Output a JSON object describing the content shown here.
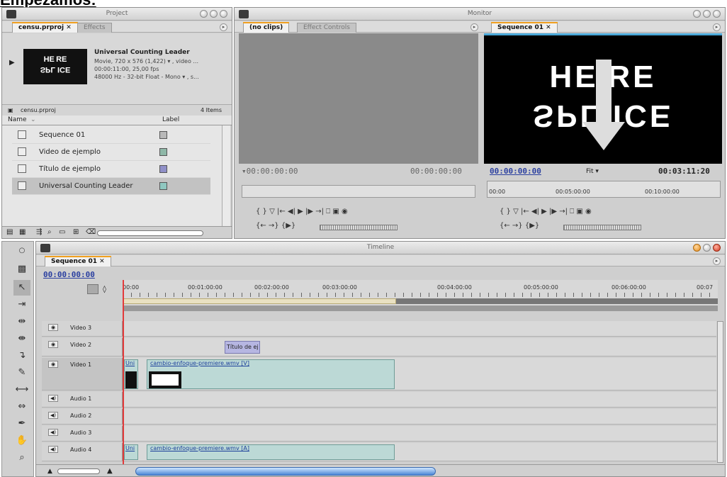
{
  "page_heading": "Empezamos:",
  "project": {
    "title": "Project",
    "tabs": [
      "censu.prproj",
      "Effects"
    ],
    "clip_name": "Universal Counting Leader",
    "clip_meta": [
      "Movie, 720 x 576 (1,422)  ▾ , video ...",
      "00:00:11:00, 25,00 fps",
      "48000 Hz - 32-bit Float - Mono  ▾ , s..."
    ],
    "thumb_top": "HE RE",
    "thumb_bottom": "SPL ICE",
    "bin_name": "censu.prproj",
    "item_count": "4 Items",
    "col_name": "Name",
    "col_label": "Label",
    "items": [
      {
        "name": "Sequence 01",
        "color": "#b8b8b8"
      },
      {
        "name": "Video de ejemplo",
        "color": "#8fb8a8"
      },
      {
        "name": "Título de ejemplo",
        "color": "#9090c8"
      },
      {
        "name": "Universal Counting Leader",
        "color": "#8fc7c0"
      }
    ]
  },
  "monitor": {
    "title": "Monitor",
    "source_tabs": [
      "(no clips)",
      "Effect Controls"
    ],
    "program_tab": "Sequence 01",
    "source_tc_left": "▾00:00:00:00",
    "source_tc_right": "00:00:00:00",
    "program_tc": "00:00:00:00",
    "fit": "Fit",
    "program_duration": "00:03:11:20",
    "preview_top": "HE RE",
    "preview_bottom": "SPL ICE",
    "ruler": [
      "00:00",
      "00:05:00:00",
      "00:10:00:00"
    ],
    "ctrl_row1": "{   }   ▽    |←  ◀|  ▶  |▶  →|    ⎕  ▣  ◉",
    "ctrl_row2": "{←  →}  {▶}",
    "prog_row1": "{   }   ▽    |←  ◀|  ▶  |▶  →|    ⎕  ▣  ◉",
    "prog_row2": "{←  →}  {▶}"
  },
  "timeline": {
    "title": "Timeline",
    "tab": "Sequence 01",
    "current_tc": "00:00:00:00",
    "ruler": [
      "00:00",
      "00:01:00:00",
      "00:02:00:00",
      "00:03:00:00",
      "00:04:00:00",
      "00:05:00:00",
      "00:06:00:00",
      "00:07"
    ],
    "tracks": [
      "Video 3",
      "Video 2",
      "Video 1",
      "Audio 1",
      "Audio 2",
      "Audio 3",
      "Audio 4"
    ],
    "title_clip": "Título de ej",
    "video_clip_label": "cambio-enfoque-premiere.wmv [V]",
    "audio_clip_label": "cambio-enfoque-premiere.wmv [A]",
    "leader_short": "Uni"
  },
  "colors": {
    "playhead": "#e23a3a",
    "accent": "#f0a020",
    "link": "#2a3fa0"
  }
}
